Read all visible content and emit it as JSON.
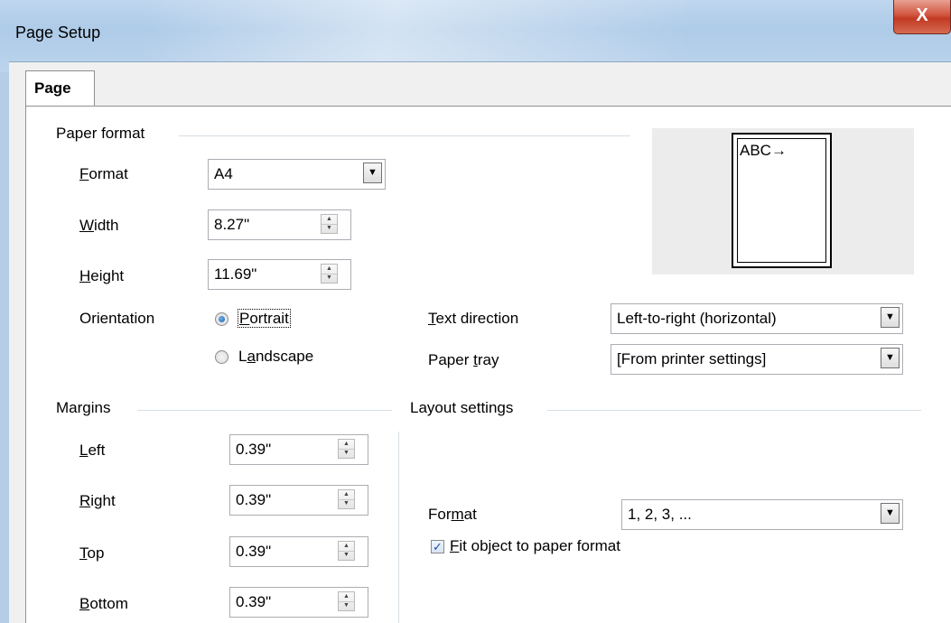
{
  "window": {
    "title": "Page Setup",
    "close_glyph": "X"
  },
  "tabs": [
    {
      "label": "Page",
      "selected": true
    }
  ],
  "paper_format": {
    "group_title": "Paper format",
    "format": {
      "label_u": "F",
      "label_rest": "ormat",
      "value": "A4"
    },
    "width": {
      "label_u": "W",
      "label_rest": "idth",
      "value": "8.27\""
    },
    "height": {
      "label_u": "H",
      "label_rest": "eight",
      "value": "11.69\""
    },
    "orientation": {
      "label": "Orientation",
      "portrait": {
        "label_u": "P",
        "label_rest": "ortrait",
        "checked": true
      },
      "landscape": {
        "label_before": "L",
        "label_u": "a",
        "label_rest": "ndscape",
        "checked": false
      }
    },
    "text_direction": {
      "label_u": "T",
      "label_rest": "ext direction",
      "value": "Left-to-right (horizontal)"
    },
    "paper_tray": {
      "label_before": "Paper ",
      "label_u": "t",
      "label_rest": "ray",
      "value": "[From printer settings]"
    }
  },
  "preview": {
    "text": "ABC→"
  },
  "margins": {
    "group_title": "Margins",
    "left": {
      "label_u": "L",
      "label_rest": "eft",
      "value": "0.39\""
    },
    "right": {
      "label_u": "R",
      "label_rest": "ight",
      "value": "0.39\""
    },
    "top": {
      "label_u": "T",
      "label_rest": "op",
      "value": "0.39\""
    },
    "bottom": {
      "label_u": "B",
      "label_rest": "ottom",
      "value": "0.39\""
    }
  },
  "layout_settings": {
    "group_title": "Layout settings",
    "format": {
      "label_before": "For",
      "label_u": "m",
      "label_rest": "at",
      "value": "1, 2, 3, ..."
    },
    "fit_object": {
      "label_u": "F",
      "label_rest": "it object to paper format",
      "checked": true
    }
  },
  "icons": {
    "dropdown": "chevron-down-icon",
    "spin_up": "spin-up-icon",
    "spin_down": "spin-down-icon",
    "check": "checkmark-icon"
  }
}
